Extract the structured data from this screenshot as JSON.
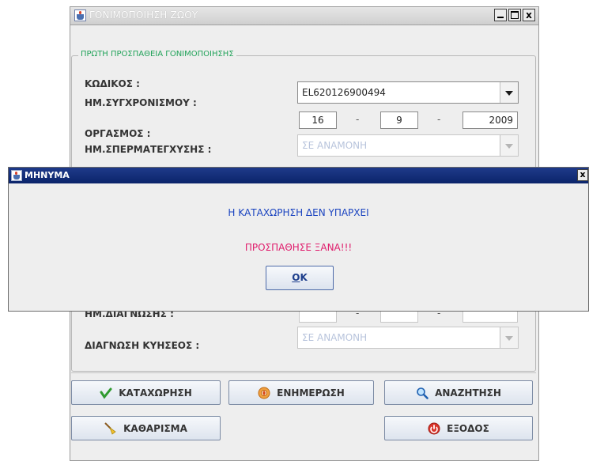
{
  "window": {
    "title": "ΓΟΝΙΜΟΠΟΙΗΣΗ ΖΩΟΥ"
  },
  "group": {
    "legend": "ΠΡΩΤΗ ΠΡΟΣΠΑΘΕΙΑ ΓΟΝΙΜΟΠΟΙΗΣΗΣ"
  },
  "form": {
    "code_label": "ΚΩΔΙΚΟΣ :",
    "code_value": "EL620126900494",
    "sync_date_label": "ΗΜ.ΣΥΓΧΡΟΝΙΣΜΟΥ :",
    "sync_day": "16",
    "sync_month": "9",
    "sync_year": "2009",
    "date_separator": "-",
    "estrus_label": "ΟΡΓΑΣΜΟΣ :",
    "semen_date_label": "ΗΜ.ΣΠΕΡΜΑΤΕΓΧΥΣΗΣ :",
    "semen_value": "ΣΕ ΑΝΑΜΟΝΗ",
    "diag_date_label_partial": "ΗΜ.ΔΙΑΓΝΩΣΗΣ :",
    "pregnancy_label": "ΔΙΑΓΝΩΣΗ ΚΥΗΣΕΟΣ :",
    "pregnancy_value": "ΣΕ ΑΝΑΜΟΝΗ"
  },
  "buttons": {
    "register": "ΚΑΤΑΧΩΡΗΣΗ",
    "update": "ΕΝΗΜΕΡΩΣΗ",
    "search": "ΑΝΑΖΗΤΗΣΗ",
    "clear": "ΚΑΘΑΡΙΣΜΑ",
    "exit": "ΕΞΟΔΟΣ"
  },
  "dialog": {
    "title": "ΜΗΝΥΜΑ",
    "message": "Η ΚΑΤΑΧΩΡΗΣΗ ΔΕΝ ΥΠΑΡΧΕΙ",
    "retry": "ΠΡΟΣΠΑΘΗΣΕ ΞΑΝΑ!!!",
    "ok_first": "O",
    "ok_rest": "K",
    "close": "x"
  },
  "colors": {
    "legend": "#22a35a",
    "message": "#1b44c0",
    "retry": "#e01c6c",
    "dialog_title": "#0b246a"
  }
}
